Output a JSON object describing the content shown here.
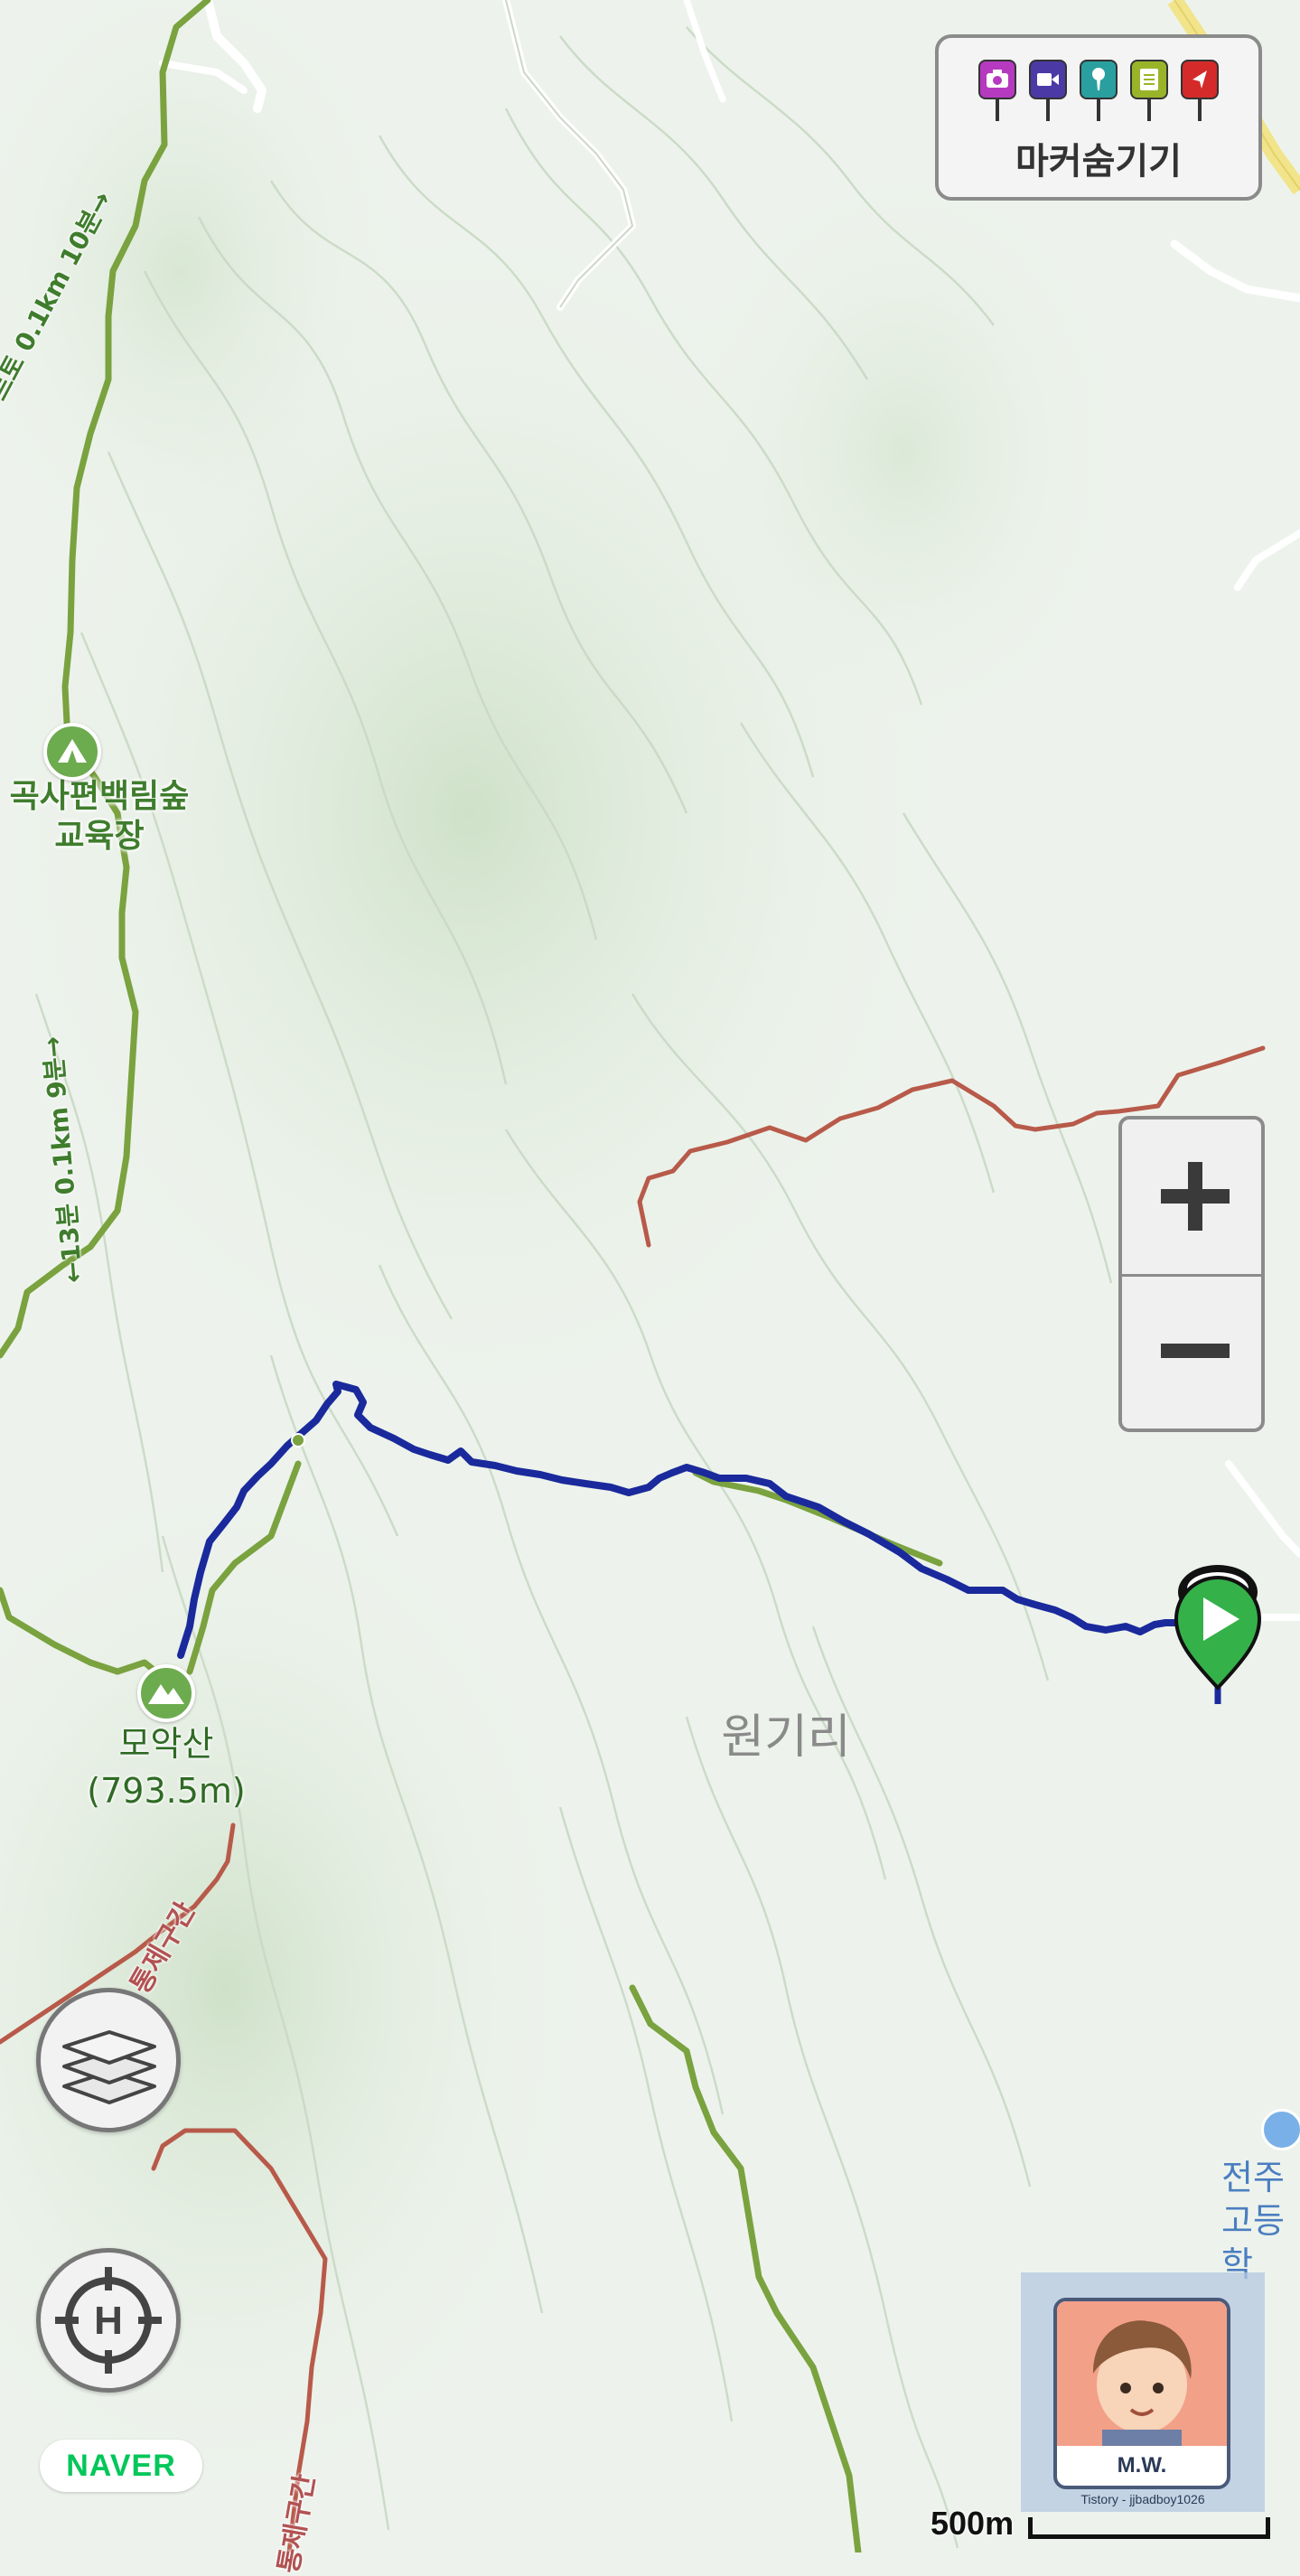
{
  "map": {
    "labels": {
      "forest_education_center": "곡사편백림숲\n교육장",
      "peak_name": "모악산",
      "peak_elevation": "(793.5m)",
      "village": "원기리",
      "school": "전주\n고등학"
    },
    "trail_labels": {
      "upper_trail": "르토 0.1km 10분→",
      "middle_trail": "←13분 0.1km 9분→"
    },
    "restricted_labels": {
      "restricted_1": "통제구간",
      "restricted_2": "통제구간"
    },
    "colors": {
      "background": "#edf3ec",
      "track": "#1a2a9c",
      "trail": "#7aa23f",
      "restricted_road": "#b85a4a",
      "road": "#ffffff",
      "start_marker": "#35b14a"
    },
    "icons": {
      "start": "play-icon",
      "camp": "tent-icon",
      "peak": "mountain-icon",
      "school": "building-icon"
    }
  },
  "controls": {
    "marker_panel": {
      "label": "마커숨기기",
      "markers": [
        {
          "icon": "camera-icon",
          "color": "#b53ac0"
        },
        {
          "icon": "video-icon",
          "color": "#4b3aa6"
        },
        {
          "icon": "microphone-icon",
          "color": "#2a9fa0"
        },
        {
          "icon": "note-icon",
          "color": "#9ab42a"
        },
        {
          "icon": "navigation-icon",
          "color": "#d42a2a"
        }
      ]
    },
    "zoom": {
      "in_symbol": "+",
      "out_symbol": "−"
    },
    "layers_icon": "layers-icon",
    "location_icon": "crosshair-icon",
    "location_letter": "H"
  },
  "footer": {
    "naver_logo": "NAVER",
    "scale": "500m",
    "watermark": {
      "name": "M.W.",
      "credit": "Tistory - jjbadboy1026"
    }
  }
}
